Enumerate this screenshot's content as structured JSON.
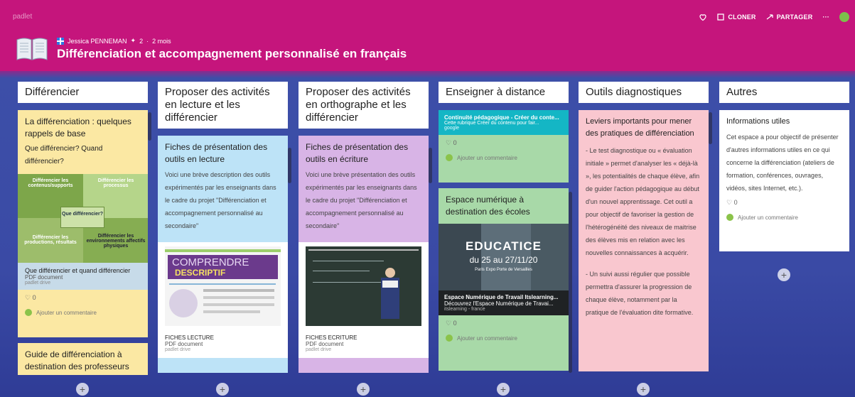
{
  "app": {
    "brand": "padlet"
  },
  "toolbar": {
    "clone": "CLONER",
    "share": "PARTAGER",
    "more": "···"
  },
  "header": {
    "author": "Jessica PENNEMAN",
    "likes": "2",
    "age": "2 mois",
    "title": "Différenciation et accompagnement personnalisé en français"
  },
  "columns": [
    {
      "title": "Différencier",
      "cards": [
        {
          "title": "La différenciation : quelques rappels de base",
          "body": "Que différencier? Quand différencier?",
          "image_labels": [
            "Différencier les contenus/supports",
            "Différencier les processus",
            "Que différencier?",
            "Différencier les productions, résultats",
            "Différencier les environnements affectifs physiques"
          ],
          "attachment": {
            "title": "Que différencier et quand différencier",
            "type": "PDF document",
            "source": "padlet drive"
          },
          "likes": "0",
          "comment": "Ajouter un commentaire"
        },
        {
          "title": "Guide de différenciation à destination des professeurs de"
        }
      ]
    },
    {
      "title": "Proposer des activités en lecture et les différencier",
      "cards": [
        {
          "title": "Fiches de présentation des outils en lecture",
          "body": "Voici une brève description des outils expérimentés par les enseignants dans le cadre du projet \"Différenciation et accompagnement personnalisé au secondaire\"",
          "image_text": [
            "COMPRENDRE",
            "DESCRIPTIF"
          ],
          "attachment": {
            "title": "FICHES LECTURE",
            "type": "PDF document",
            "source": "padlet drive"
          }
        }
      ]
    },
    {
      "title": "Proposer des activités en orthographe et les différencier",
      "cards": [
        {
          "title": "Fiches de présentation des outils en écriture",
          "body": "Voici une brève présentation des outils expérimentés par les enseignants dans le cadre du projet \"Différenciation et accompagnement personnalisé au secondaire\"",
          "attachment": {
            "title": "FICHES ECRITURE",
            "type": "PDF document",
            "source": "padlet drive"
          }
        }
      ]
    },
    {
      "title": "Enseigner à distance",
      "cards": [
        {
          "link": {
            "title": "Continuité pédagogique - Créer du conte...",
            "desc": "Cette rubrique Créer du contenu pour fair...",
            "source": "google"
          },
          "likes": "0",
          "comment": "Ajouter un commentaire"
        },
        {
          "title": "Espace numérique à destination des écoles",
          "image_text": [
            "EDUCATICE",
            "du 25 au 27/11/20",
            "Paris Expo Porte de Versailles"
          ],
          "link": {
            "title": "Espace Numérique de Travail Itslearning...",
            "desc": "Découvrez l'Espace Numérique de Travai...",
            "source": "itslearning - france"
          },
          "likes": "0",
          "comment": "Ajouter un commentaire"
        }
      ]
    },
    {
      "title": "Outils diagnostiques",
      "cards": [
        {
          "title": "Leviers importants pour mener des pratiques de différenciation",
          "p1": "- Le test diagnostique ou « évaluation initiale » permet d'analyser les « déjà-là », les potentialités de chaque élève, afin de guider l'action pédagogique au début d'un nouvel apprentissage. Cet outil a pour objectif de favoriser la gestion de l'hétérogénéité des niveaux de maitrise des élèves mis en relation avec les nouvelles connaissances à acquérir.",
          "p2": "- Un suivi aussi régulier que possible permettra d'assurer la progression de chaque élève, notamment par la pratique de l'évaluation dite formative."
        }
      ]
    },
    {
      "title": "Autres",
      "cards": [
        {
          "title": "Informations utiles",
          "body": "Cet espace a pour objectif de présenter d'autres informations utiles en ce qui concerne la différenciation (ateliers de formation, conférences, ouvrages, vidéos, sites Internet, etc.).",
          "likes": "0",
          "comment": "Ajouter un commentaire"
        }
      ]
    }
  ],
  "add_label": "+",
  "colors": {
    "header": "#c5157c",
    "background": "#3a4aa5",
    "yellow": "#fbe8a3",
    "blue": "#bde3f7",
    "purple": "#d8b4e6",
    "green": "#a8d9a8",
    "pink": "#f9c7cf",
    "teal": "#14b6c5"
  },
  "icons": [
    "heart-icon",
    "clone-icon",
    "share-icon",
    "more-icon",
    "globe-icon",
    "book-icon",
    "flag-icon",
    "comment-icon",
    "add-icon"
  ]
}
